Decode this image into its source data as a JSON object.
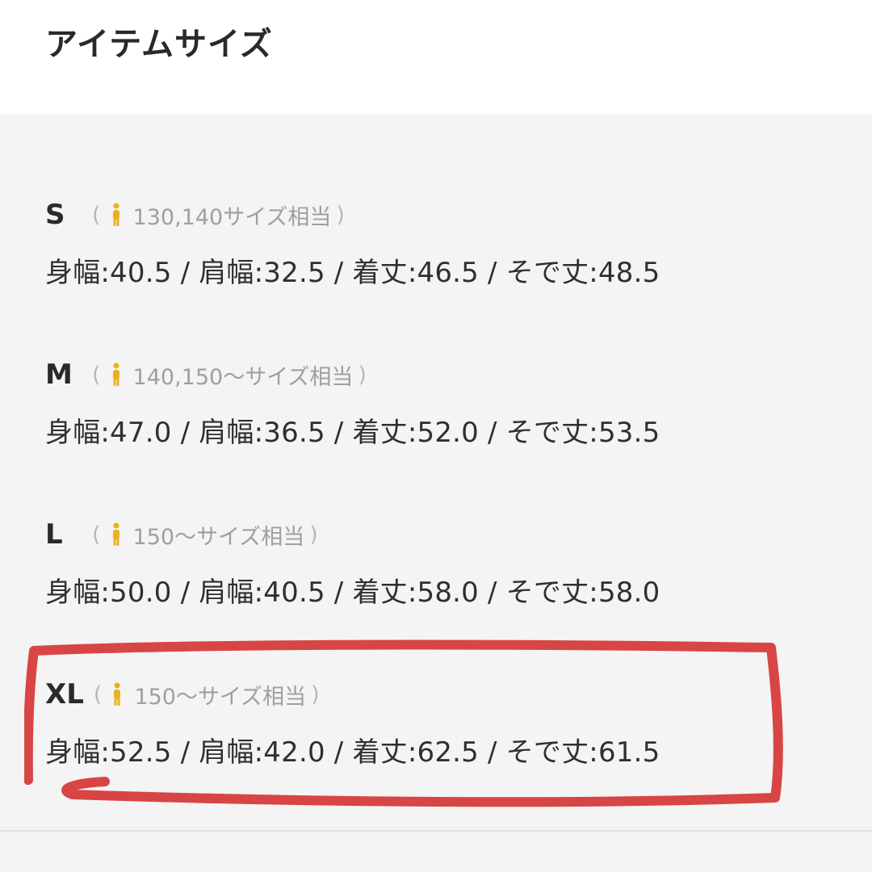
{
  "header": {
    "title": "アイテムサイズ"
  },
  "sizes": [
    {
      "label": "S",
      "note": "130,140サイズ相当",
      "measure": "身幅:40.5 / 肩幅:32.5 / 着丈:46.5 / そで丈:48.5"
    },
    {
      "label": "M",
      "note": "140,150〜サイズ相当",
      "measure": "身幅:47.0 / 肩幅:36.5 / 着丈:52.0 / そで丈:53.5"
    },
    {
      "label": "L",
      "note": "150〜サイズ相当",
      "measure": "身幅:50.0 / 肩幅:40.5 / 着丈:58.0 / そで丈:58.0"
    },
    {
      "label": "XL",
      "note": "150〜サイズ相当",
      "measure": "身幅:52.5 / 肩幅:42.0 / 着丈:62.5 / そで丈:61.5"
    }
  ],
  "icons": {
    "person": "person-icon",
    "person_color": "#e8b21e"
  },
  "highlight": {
    "color": "#d84545",
    "target": "XL"
  },
  "colors": {
    "panel": "#f4f4f4",
    "text": "#2b2b2b",
    "muted": "#9f9f9f"
  }
}
